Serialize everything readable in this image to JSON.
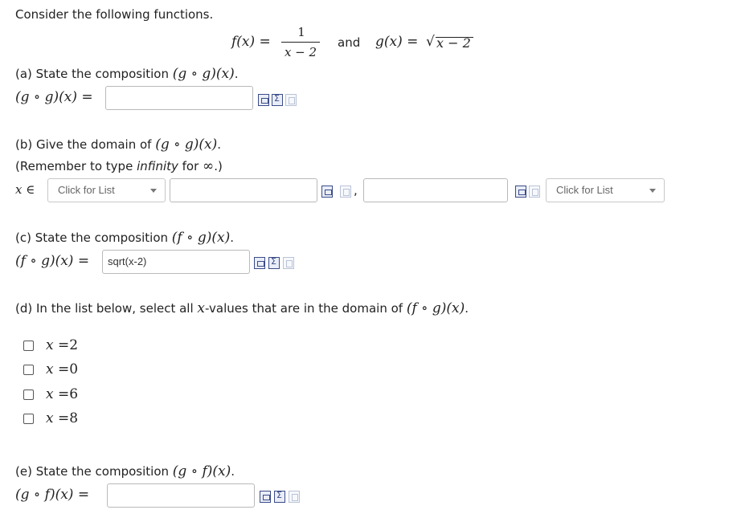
{
  "intro": "Consider the following functions.",
  "functions": {
    "f_lhs": "f(x) =",
    "f_num": "1",
    "f_den": "x − 2",
    "and": "and",
    "g_lhs": "g(x) =",
    "g_root": "√",
    "g_radicand": "x − 2"
  },
  "part_a": {
    "prompt_text": "(a) State the composition ",
    "prompt_math": "(g ∘ g)(x)",
    "prompt_end": ".",
    "lhs": "(g ∘ g)(x) =",
    "answer_value": ""
  },
  "part_b": {
    "prompt_text": "(b) Give the domain of ",
    "prompt_math": "(g ∘ g)(x)",
    "prompt_end": ".",
    "remember_1": "(Remember to type ",
    "remember_italic": "infinity",
    "remember_2": " for ",
    "remember_sym": "∞",
    "remember_3": ".)",
    "lhs": "x ∈",
    "left_bracket_select": "Click for List",
    "lower_value": "",
    "comma": ",",
    "upper_value": "",
    "right_bracket_select": "Click for List"
  },
  "part_c": {
    "prompt_text": "(c) State the composition ",
    "prompt_math": "(f ∘ g)(x)",
    "prompt_end": ".",
    "lhs": "(f ∘ g)(x) =",
    "answer_value": "sqrt(x-2)"
  },
  "part_d": {
    "prompt_text_1": "(d) In the list below, select all ",
    "prompt_var": "x",
    "prompt_text_2": "-values that are in the domain of ",
    "prompt_math": "(f ∘ g)(x)",
    "prompt_end": ".",
    "options": [
      {
        "var": "x",
        "eq": "=",
        "val": "2"
      },
      {
        "var": "x",
        "eq": "=",
        "val": "0"
      },
      {
        "var": "x",
        "eq": "=",
        "val": "6"
      },
      {
        "var": "x",
        "eq": "=",
        "val": "8"
      }
    ]
  },
  "part_e": {
    "prompt_text": "(e) State the composition ",
    "prompt_math": "(g ∘ f)(x)",
    "prompt_end": ".",
    "lhs": "(g ∘ f)(x) =",
    "answer_value": ""
  }
}
